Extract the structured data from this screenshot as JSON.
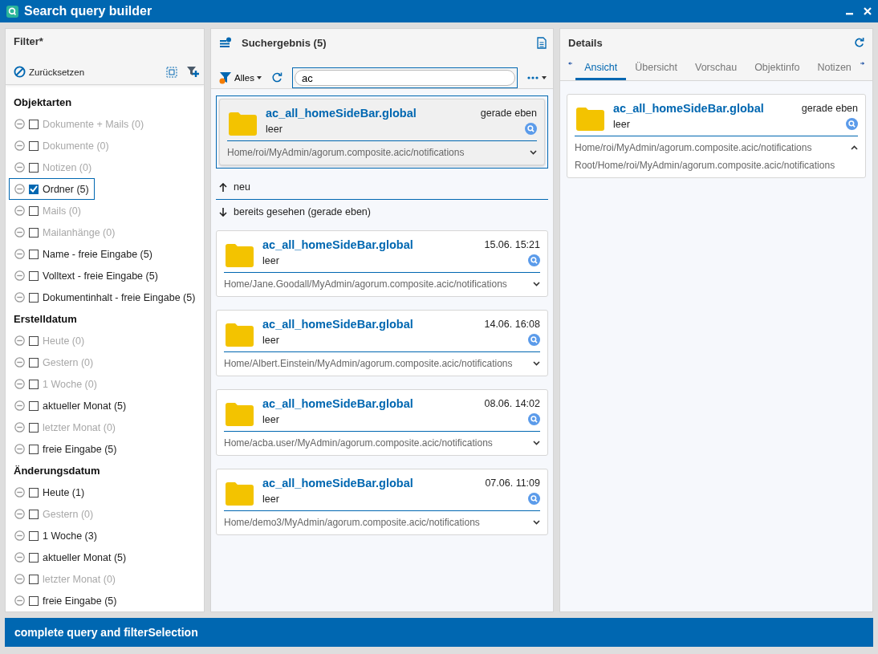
{
  "window": {
    "title": "Search query builder"
  },
  "filter": {
    "title": "Filter*",
    "reset": "Zurücksetzen",
    "sections": [
      {
        "heading": "Objektarten",
        "items": [
          {
            "label": "Dokumente + Mails (0)",
            "checked": false,
            "disabled": true,
            "focused": false
          },
          {
            "label": "Dokumente (0)",
            "checked": false,
            "disabled": true,
            "focused": false
          },
          {
            "label": "Notizen (0)",
            "checked": false,
            "disabled": true,
            "focused": false
          },
          {
            "label": "Ordner (5)",
            "checked": true,
            "disabled": false,
            "focused": true
          },
          {
            "label": "Mails (0)",
            "checked": false,
            "disabled": true,
            "focused": false
          },
          {
            "label": "Mailanhänge (0)",
            "checked": false,
            "disabled": true,
            "focused": false
          },
          {
            "label": "Name - freie Eingabe (5)",
            "checked": false,
            "disabled": false,
            "focused": false
          },
          {
            "label": "Volltext - freie Eingabe (5)",
            "checked": false,
            "disabled": false,
            "focused": false
          },
          {
            "label": "Dokumentinhalt - freie Eingabe (5)",
            "checked": false,
            "disabled": false,
            "focused": false
          }
        ]
      },
      {
        "heading": "Erstelldatum",
        "items": [
          {
            "label": "Heute (0)",
            "checked": false,
            "disabled": true,
            "focused": false
          },
          {
            "label": "Gestern (0)",
            "checked": false,
            "disabled": true,
            "focused": false
          },
          {
            "label": "1 Woche (0)",
            "checked": false,
            "disabled": true,
            "focused": false
          },
          {
            "label": "aktueller Monat (5)",
            "checked": false,
            "disabled": false,
            "focused": false
          },
          {
            "label": "letzter Monat (0)",
            "checked": false,
            "disabled": true,
            "focused": false
          },
          {
            "label": "freie Eingabe (5)",
            "checked": false,
            "disabled": false,
            "focused": false
          }
        ]
      },
      {
        "heading": "Änderungsdatum",
        "items": [
          {
            "label": "Heute (1)",
            "checked": false,
            "disabled": false,
            "focused": false
          },
          {
            "label": "Gestern (0)",
            "checked": false,
            "disabled": true,
            "focused": false
          },
          {
            "label": "1 Woche (3)",
            "checked": false,
            "disabled": false,
            "focused": false
          },
          {
            "label": "aktueller Monat (5)",
            "checked": false,
            "disabled": false,
            "focused": false
          },
          {
            "label": "letzter Monat (0)",
            "checked": false,
            "disabled": true,
            "focused": false
          },
          {
            "label": "freie Eingabe (5)",
            "checked": false,
            "disabled": false,
            "focused": false
          }
        ]
      }
    ]
  },
  "results": {
    "title": "Suchergebnis (5)",
    "scope": "Alles",
    "search": {
      "value": "ac"
    },
    "pinned": {
      "title": "ac_all_homeSideBar.global",
      "time": "gerade eben",
      "subtitle": "leer",
      "path": "Home/roi/MyAdmin/agorum.composite.acic/notifications",
      "selected": true,
      "expanded": false
    },
    "sections": [
      {
        "kind": "up",
        "label": "neu"
      },
      {
        "kind": "down",
        "label": "bereits gesehen (gerade eben)",
        "cards": [
          {
            "title": "ac_all_homeSideBar.global",
            "time": "15.06. 15:21",
            "subtitle": "leer",
            "path": "Home/Jane.Goodall/MyAdmin/agorum.composite.acic/notifications",
            "selected": false,
            "expanded": false
          },
          {
            "title": "ac_all_homeSideBar.global",
            "time": "14.06. 16:08",
            "subtitle": "leer",
            "path": "Home/Albert.Einstein/MyAdmin/agorum.composite.acic/notifications",
            "selected": false,
            "expanded": false
          },
          {
            "title": "ac_all_homeSideBar.global",
            "time": "08.06. 14:02",
            "subtitle": "leer",
            "path": "Home/acba.user/MyAdmin/agorum.composite.acic/notifications",
            "selected": false,
            "expanded": false
          },
          {
            "title": "ac_all_homeSideBar.global",
            "time": "07.06. 11:09",
            "subtitle": "leer",
            "path": "Home/demo3/MyAdmin/agorum.composite.acic/notifications",
            "selected": false,
            "expanded": false
          }
        ]
      }
    ]
  },
  "details": {
    "title": "Details",
    "tabs": [
      {
        "label": "Ansicht",
        "selected": true
      },
      {
        "label": "Übersicht",
        "selected": false
      },
      {
        "label": "Vorschau",
        "selected": false
      },
      {
        "label": "Objektinfo",
        "selected": false
      },
      {
        "label": "Notizen",
        "selected": false
      }
    ],
    "card": {
      "title": "ac_all_homeSideBar.global",
      "time": "gerade eben",
      "subtitle": "leer",
      "path": "Home/roi/MyAdmin/agorum.composite.acic/notifications",
      "full_path": "Root/Home/roi/MyAdmin/agorum.composite.acic/notifications",
      "expanded": true
    }
  },
  "footer": {
    "label": "complete query and filterSelection"
  }
}
